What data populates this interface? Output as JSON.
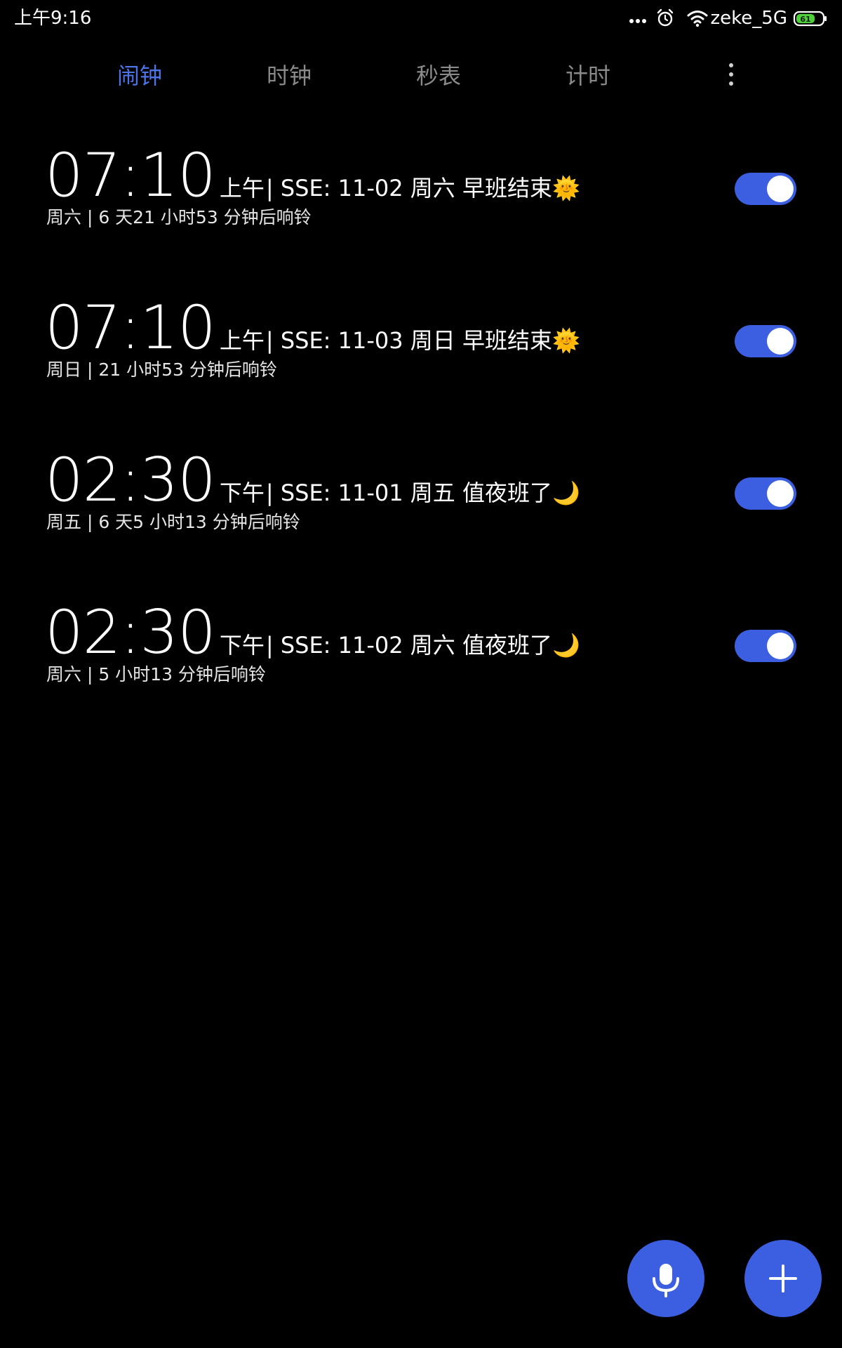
{
  "status_bar": {
    "time": "上午9:16",
    "wifi_name": "zeke_5G",
    "battery_level": "61",
    "icons": [
      "more-dots-icon",
      "alarm-clock-icon",
      "wifi-icon",
      "battery-icon"
    ]
  },
  "tabs": [
    {
      "label": "闹钟",
      "active": true
    },
    {
      "label": "时钟",
      "active": false
    },
    {
      "label": "秒表",
      "active": false
    },
    {
      "label": "计时",
      "active": false
    }
  ],
  "more_menu_icon": "vertical-dots-icon",
  "alarms": [
    {
      "time": "07:10",
      "period": "上午",
      "label": "| SSE: 11-02 周六 早班结束🌞",
      "subtitle": "周六 | 6 天21 小时53 分钟后响铃",
      "enabled": true
    },
    {
      "time": "07:10",
      "period": "上午",
      "label": "| SSE: 11-03 周日 早班结束🌞",
      "subtitle": "周日 | 21 小时53 分钟后响铃",
      "enabled": true
    },
    {
      "time": "02:30",
      "period": "下午",
      "label": "| SSE: 11-01 周五 值夜班了🌙",
      "subtitle": "周五 | 6 天5 小时13 分钟后响铃",
      "enabled": true
    },
    {
      "time": "02:30",
      "period": "下午",
      "label": "| SSE: 11-02 周六 值夜班了🌙",
      "subtitle": "周六 | 5 小时13 分钟后响铃",
      "enabled": true
    }
  ],
  "fab_icons": {
    "voice": "microphone-icon",
    "add": "plus-icon"
  },
  "colors": {
    "background": "#000000",
    "accent": "#3b5fe0",
    "active_tab": "#4c74e6",
    "inactive_tab": "#8a8a8a",
    "battery_fill": "#4cd137"
  }
}
